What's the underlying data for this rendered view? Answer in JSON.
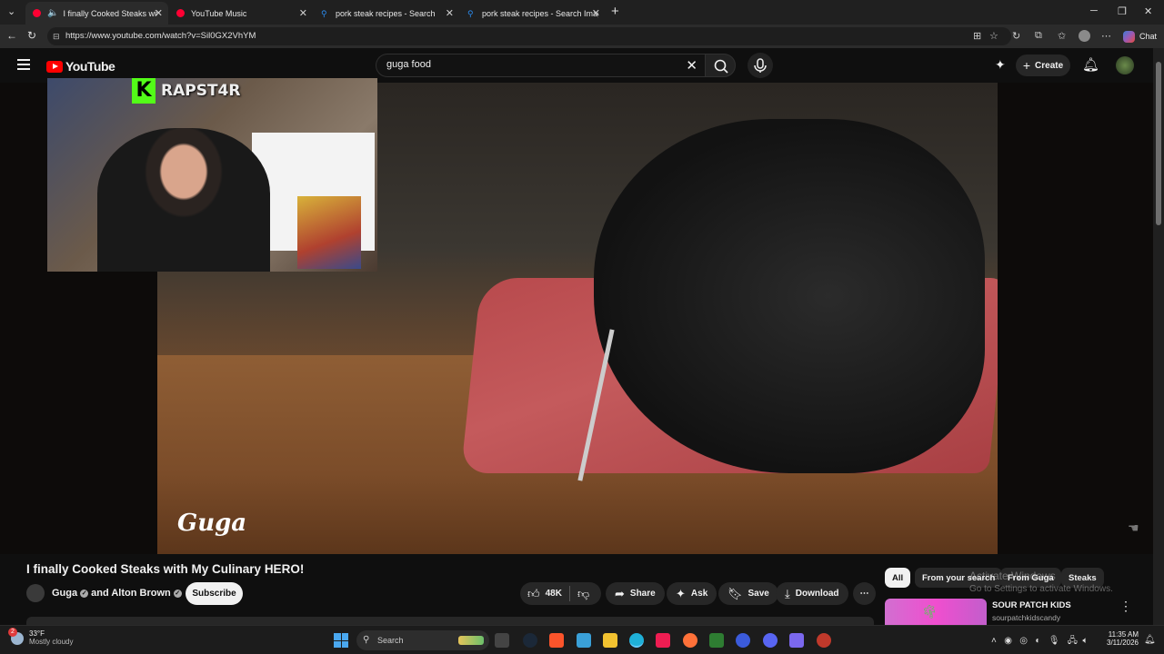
{
  "browser": {
    "tabs": [
      {
        "label": "I finally Cooked Steaks with M",
        "active": true,
        "favicon_color": "#ff0033"
      },
      {
        "label": "YouTube Music",
        "active": false,
        "favicon_color": "#ff0033"
      },
      {
        "label": "pork steak recipes - Search",
        "active": false,
        "favicon_color": "#2a8cf0"
      },
      {
        "label": "pork steak recipes - Search Images",
        "active": false,
        "favicon_color": "#2a8cf0"
      }
    ],
    "url": "https://www.youtube.com/watch?v=Sil0GX2VhYM",
    "chat_label": "Chat"
  },
  "youtube": {
    "logo_text": "YouTube",
    "search": {
      "value": "guga food",
      "placeholder": "Search"
    },
    "create_label": "Create"
  },
  "video": {
    "overlay_channel": "RAPST4R",
    "overlay_brand_letter": "K",
    "watermark": "Guga",
    "title": "I finally Cooked Steaks with My Culinary HERO!",
    "channel": "Guga",
    "channel_joiner": "and",
    "collab": "Alton Brown",
    "subscribe_label": "Subscribe",
    "likes": "48K",
    "share_label": "Share",
    "ask_label": "Ask",
    "save_label": "Save",
    "download_label": "Download"
  },
  "sidebar": {
    "chips": [
      "All",
      "From your search",
      "From Guga",
      "Steaks"
    ],
    "selected_chip": "All",
    "recommendation": {
      "title": "SOUR PATCH KIDS",
      "channel": "sourpatchkidscandy"
    }
  },
  "watermark_windows": {
    "line1": "Activate Windows",
    "line2": "Go to Settings to activate Windows."
  },
  "taskbar": {
    "weather_temp": "33°F",
    "weather_desc": "Mostly cloudy",
    "weather_badge": "2",
    "search_label": "Search",
    "time": "11:35 AM",
    "date": "3/11/2026"
  },
  "colors": {
    "accent_red": "#ff0000",
    "kick_green": "#53fc18",
    "bg": "#0f0f0f"
  }
}
